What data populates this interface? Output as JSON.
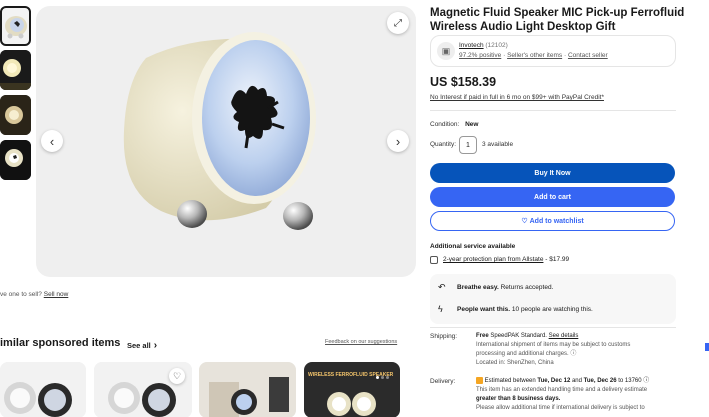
{
  "product": {
    "title": "Magnetic Fluid Speaker MIC Pick-up Ferrofluid Wireless Audio Light Desktop Gift",
    "price": "US $158.39",
    "credit_text": "No Interest if paid in full in 6 mo on $99+ with PayPal Credit*"
  },
  "seller": {
    "name": "Invotech",
    "count": "(12102)",
    "positive": "97.2% positive",
    "other_items": "Seller's other items",
    "contact": "Contact seller"
  },
  "condition": {
    "label": "Condition:",
    "value": "New"
  },
  "quantity": {
    "label": "Quantity:",
    "value": "1",
    "available": "3 available"
  },
  "buttons": {
    "buy_now": "Buy It Now",
    "add_to_cart": "Add to cart",
    "watchlist": "Add to watchlist"
  },
  "additional_service": {
    "heading": "Additional service available",
    "plan": "2-year protection plan from Allstate",
    "plan_price": "- $17.99"
  },
  "info": {
    "breathe_strong": "Breathe easy.",
    "breathe_rest": "Returns accepted.",
    "people_strong": "People want this.",
    "people_rest": "10 people are watching this."
  },
  "shipping": {
    "label": "Shipping:",
    "line1_free": "Free",
    "line1_method": "SpeedPAK Standard.",
    "line1_link": "See details",
    "line2": "International shipment of items may be subject to customs",
    "line3": "processing and additional charges.",
    "line4": "Located in: ShenZhen, China"
  },
  "delivery": {
    "label": "Delivery:",
    "line1_pre": "Estimated between",
    "date1": "Tue, Dec 12",
    "and": "and",
    "date2": "Tue, Dec 26",
    "line1_post": "to 13760",
    "line2": "This item has an extended handling time and a delivery estimate",
    "line3": "greater than 8 business days.",
    "line4": "Please allow additional time if international delivery is subject to"
  },
  "sell": {
    "text": "ve one to sell?",
    "link": "Sell now"
  },
  "sponsored": {
    "heading": "imilar sponsored items",
    "see_all": "See all",
    "feedback": "Feedback on our suggestions",
    "card4_banner": "WIRELESS FERROFLUID SPEAKER"
  },
  "colors": {
    "buy_now": "#0654ba",
    "add_to_cart": "#3665f3",
    "link": "#0654ba",
    "speaker_body": "#e2dcc3"
  }
}
